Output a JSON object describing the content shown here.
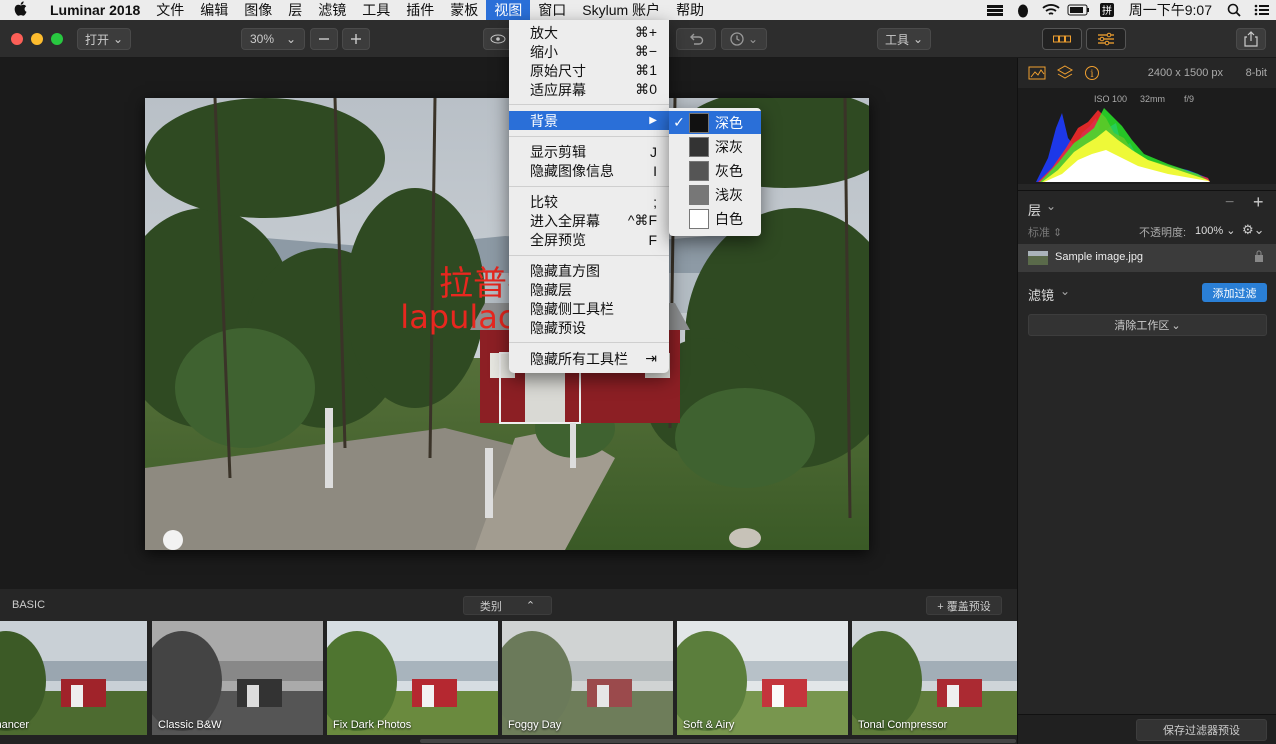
{
  "menubar": {
    "app_name": "Luminar 2018",
    "items": [
      "文件",
      "编辑",
      "图像",
      "层",
      "滤镜",
      "工具",
      "插件",
      "蒙板",
      "视图",
      "窗口",
      "Skylum 账户",
      "帮助"
    ],
    "active": "视图",
    "clock": "周一下午9:07"
  },
  "toolbar": {
    "open_label": "打开",
    "zoom_value": "30%",
    "tools_label": "工具"
  },
  "view_menu": {
    "items": [
      {
        "label": "放大",
        "shortcut": "⌘+"
      },
      {
        "label": "缩小",
        "shortcut": "⌘−"
      },
      {
        "label": "原始尺寸",
        "shortcut": "⌘1"
      },
      {
        "label": "适应屏幕",
        "shortcut": "⌘0"
      },
      {
        "label": "背景",
        "shortcut": "▶"
      },
      {
        "label": "显示剪辑",
        "shortcut": "J"
      },
      {
        "label": "隐藏图像信息",
        "shortcut": "I"
      },
      {
        "label": "比较",
        "shortcut": ";"
      },
      {
        "label": "进入全屏幕",
        "shortcut": "^⌘F"
      },
      {
        "label": "全屏预览",
        "shortcut": "F"
      },
      {
        "label": "隐藏直方图",
        "shortcut": ""
      },
      {
        "label": "隐藏层",
        "shortcut": ""
      },
      {
        "label": "隐藏侧工具栏",
        "shortcut": ""
      },
      {
        "label": "隐藏预设",
        "shortcut": ""
      },
      {
        "label": "隐藏所有工具栏",
        "shortcut": "⇥"
      }
    ]
  },
  "background_submenu": {
    "items": [
      {
        "label": "深色",
        "color": "#111111",
        "checked": true
      },
      {
        "label": "深灰",
        "color": "#333333",
        "checked": false
      },
      {
        "label": "灰色",
        "color": "#555555",
        "checked": false
      },
      {
        "label": "浅灰",
        "color": "#777777",
        "checked": false
      },
      {
        "label": "白色",
        "color": "#ffffff",
        "checked": false
      }
    ]
  },
  "watermark": {
    "line1": "拉普拉斯",
    "line2": "lapulace.com"
  },
  "info": {
    "dimensions": "2400 x 1500 px",
    "bit_depth": "8-bit",
    "iso": "ISO 100",
    "focal": "32mm",
    "aperture": "f/9"
  },
  "layers": {
    "title": "层",
    "blend_mode": "标准",
    "opacity_label": "不透明度:",
    "opacity_value": "100%",
    "layer_name": "Sample image.jpg"
  },
  "filters": {
    "title": "滤镜",
    "add_button": "添加过滤",
    "clear_button": "清除工作区",
    "save_button": "保存过滤器预设"
  },
  "presets": {
    "category_label": "BASIC",
    "filter_label": "类别",
    "overlay_label": "+ 覆盖预设",
    "items": [
      "Enhancer",
      "Classic B&W",
      "Fix Dark Photos",
      "Foggy Day",
      "Soft & Airy",
      "Tonal Compressor"
    ]
  }
}
